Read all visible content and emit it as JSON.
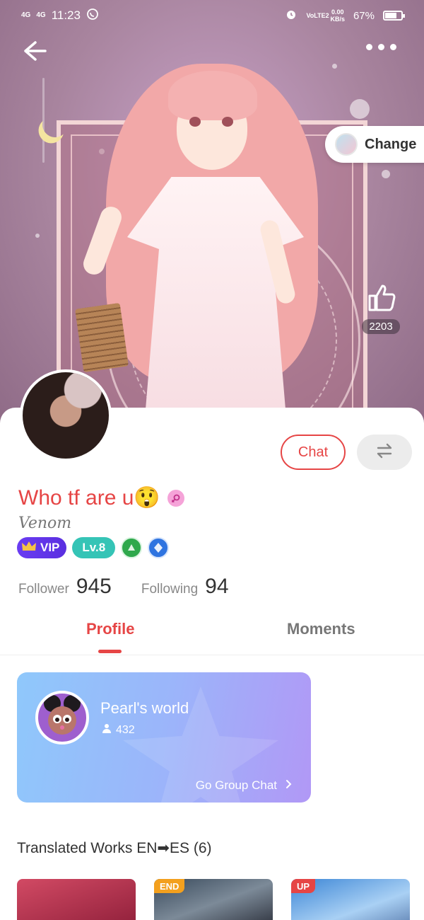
{
  "status_bar": {
    "network_left": "4G",
    "network_left_2": "4G",
    "time": "11:23",
    "volte": "VoLTE2",
    "speed_value": "0.00",
    "speed_unit": "KB/s",
    "battery": "67%"
  },
  "hero": {
    "change_label": "Change",
    "like_count": "2203"
  },
  "profile": {
    "username": "Who tf are u😲",
    "signature": "Venom",
    "vip_label": "VIP",
    "level_label": "Lv.8",
    "chat_label": "Chat",
    "follower_label": "Follower",
    "follower_count": "945",
    "following_label": "Following",
    "following_count": "94"
  },
  "tabs": {
    "profile": "Profile",
    "moments": "Moments"
  },
  "group": {
    "name": "Pearl's world",
    "members": "432",
    "go_label": "Go Group Chat"
  },
  "works": {
    "title": "Translated Works EN➡ES (6)",
    "items": [
      {
        "tag": ""
      },
      {
        "tag": "END"
      },
      {
        "tag": "UP"
      }
    ]
  },
  "colors": {
    "accent": "#e64545",
    "vip": "#5a2fe0",
    "level": "#35c4b6"
  }
}
